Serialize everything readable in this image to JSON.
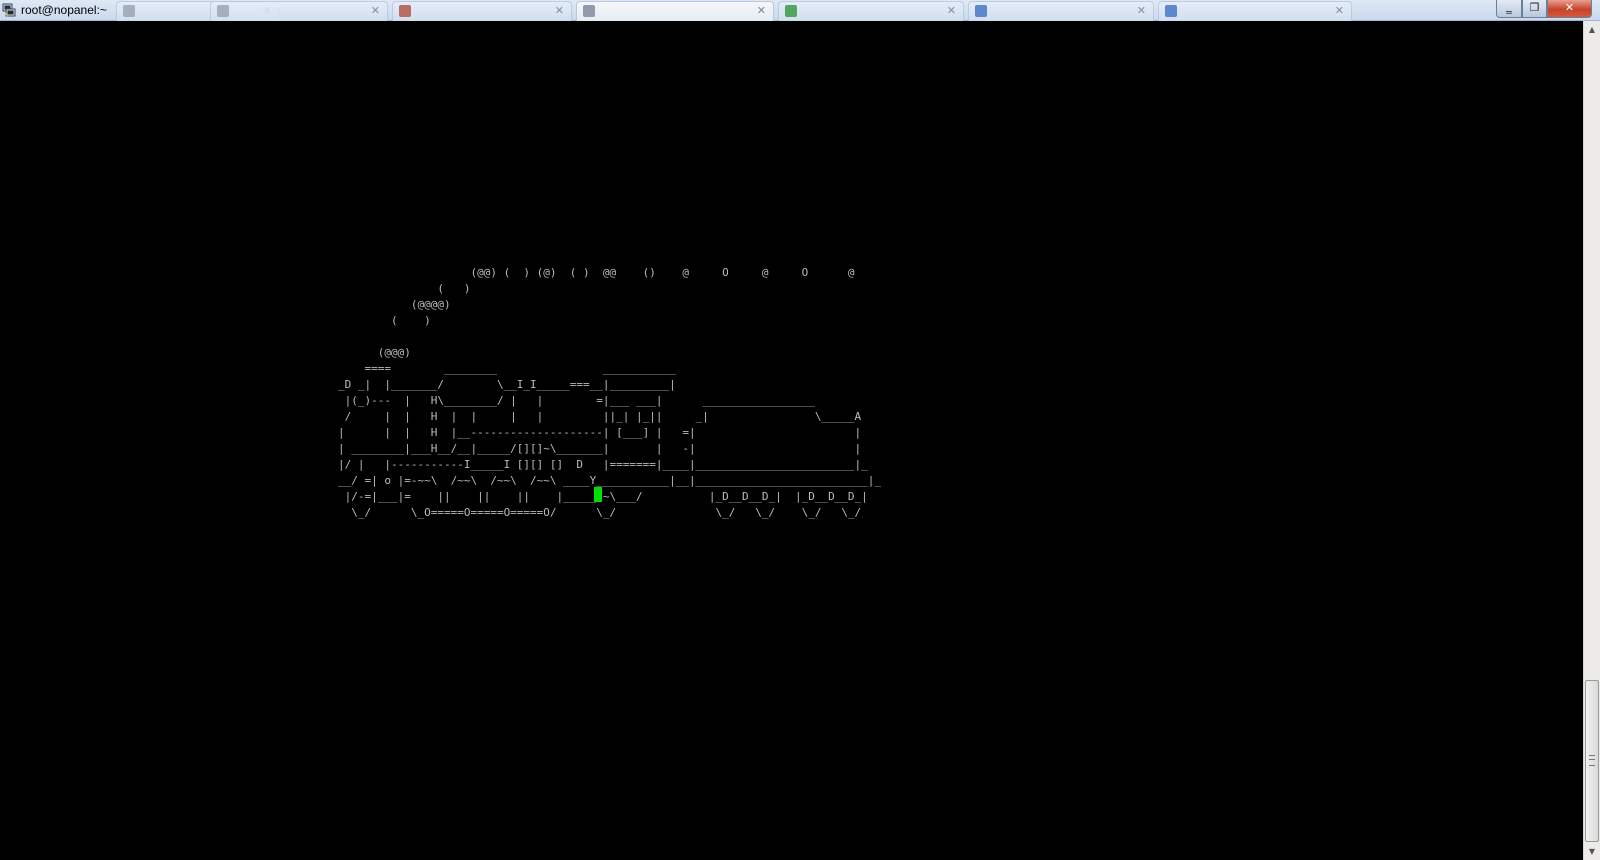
{
  "window": {
    "title": "root@nopanel:~"
  },
  "background_tabs": [
    {
      "label": "",
      "fav_color": "#9aa7b8"
    },
    {
      "label": "",
      "fav_color": "#b35a4f"
    },
    {
      "label": "",
      "fav_color": "#8f98a6",
      "active": true
    },
    {
      "label": "",
      "fav_color": "#3f9b4a"
    },
    {
      "label": "",
      "fav_color": "#4a79c8"
    },
    {
      "label": "",
      "fav_color": "#4a79c8"
    }
  ],
  "window_controls": {
    "minimize": "‗",
    "maximize": "❐",
    "close": "✕"
  },
  "terminal": {
    "art_lines": [
      "                    (@@) (  ) (@)  ( )  @@    ()    @     O     @     O      @",
      "               (   )",
      "           (@@@@)",
      "        (    )",
      "",
      "      (@@@)",
      "    ====        ________                ___________",
      "_D _|  |_______/        \\__I_I_____===__|_________|",
      " |(_)---  |   H\\________/ |   |        =|___ ___|      _________________",
      " /     |  |   H  |  |     |   |         ||_| |_||     _|                \\_____A",
      "|      |  |   H  |__--------------------| [___] |   =|                        |",
      "| ________|___H__/__|_____/[][]~\\_______|       |   -|                        |",
      "|/ |   |-----------I_____I [][] []  D   |=======|____|________________________|_",
      "__/ =| o |=-~~\\  /~~\\  /~~\\  /~~\\ ____Y___________|__|__________________________|_",
      " |/-=|___|=    ||    ||    ||    |_____/~\\___/          |_D__D__D_|  |_D__D__D_|",
      "  \\_/      \\_O=====O=====O=====O/      \\_/               \\_/   \\_/    \\_/   \\_/"
    ]
  },
  "scrollbar": {
    "up_arrow": "▲",
    "down_arrow": "▼"
  },
  "colors": {
    "terminal_bg": "#000000",
    "terminal_fg": "#bbbbbb",
    "cursor": "#00e000",
    "close_button": "#c7432a"
  }
}
